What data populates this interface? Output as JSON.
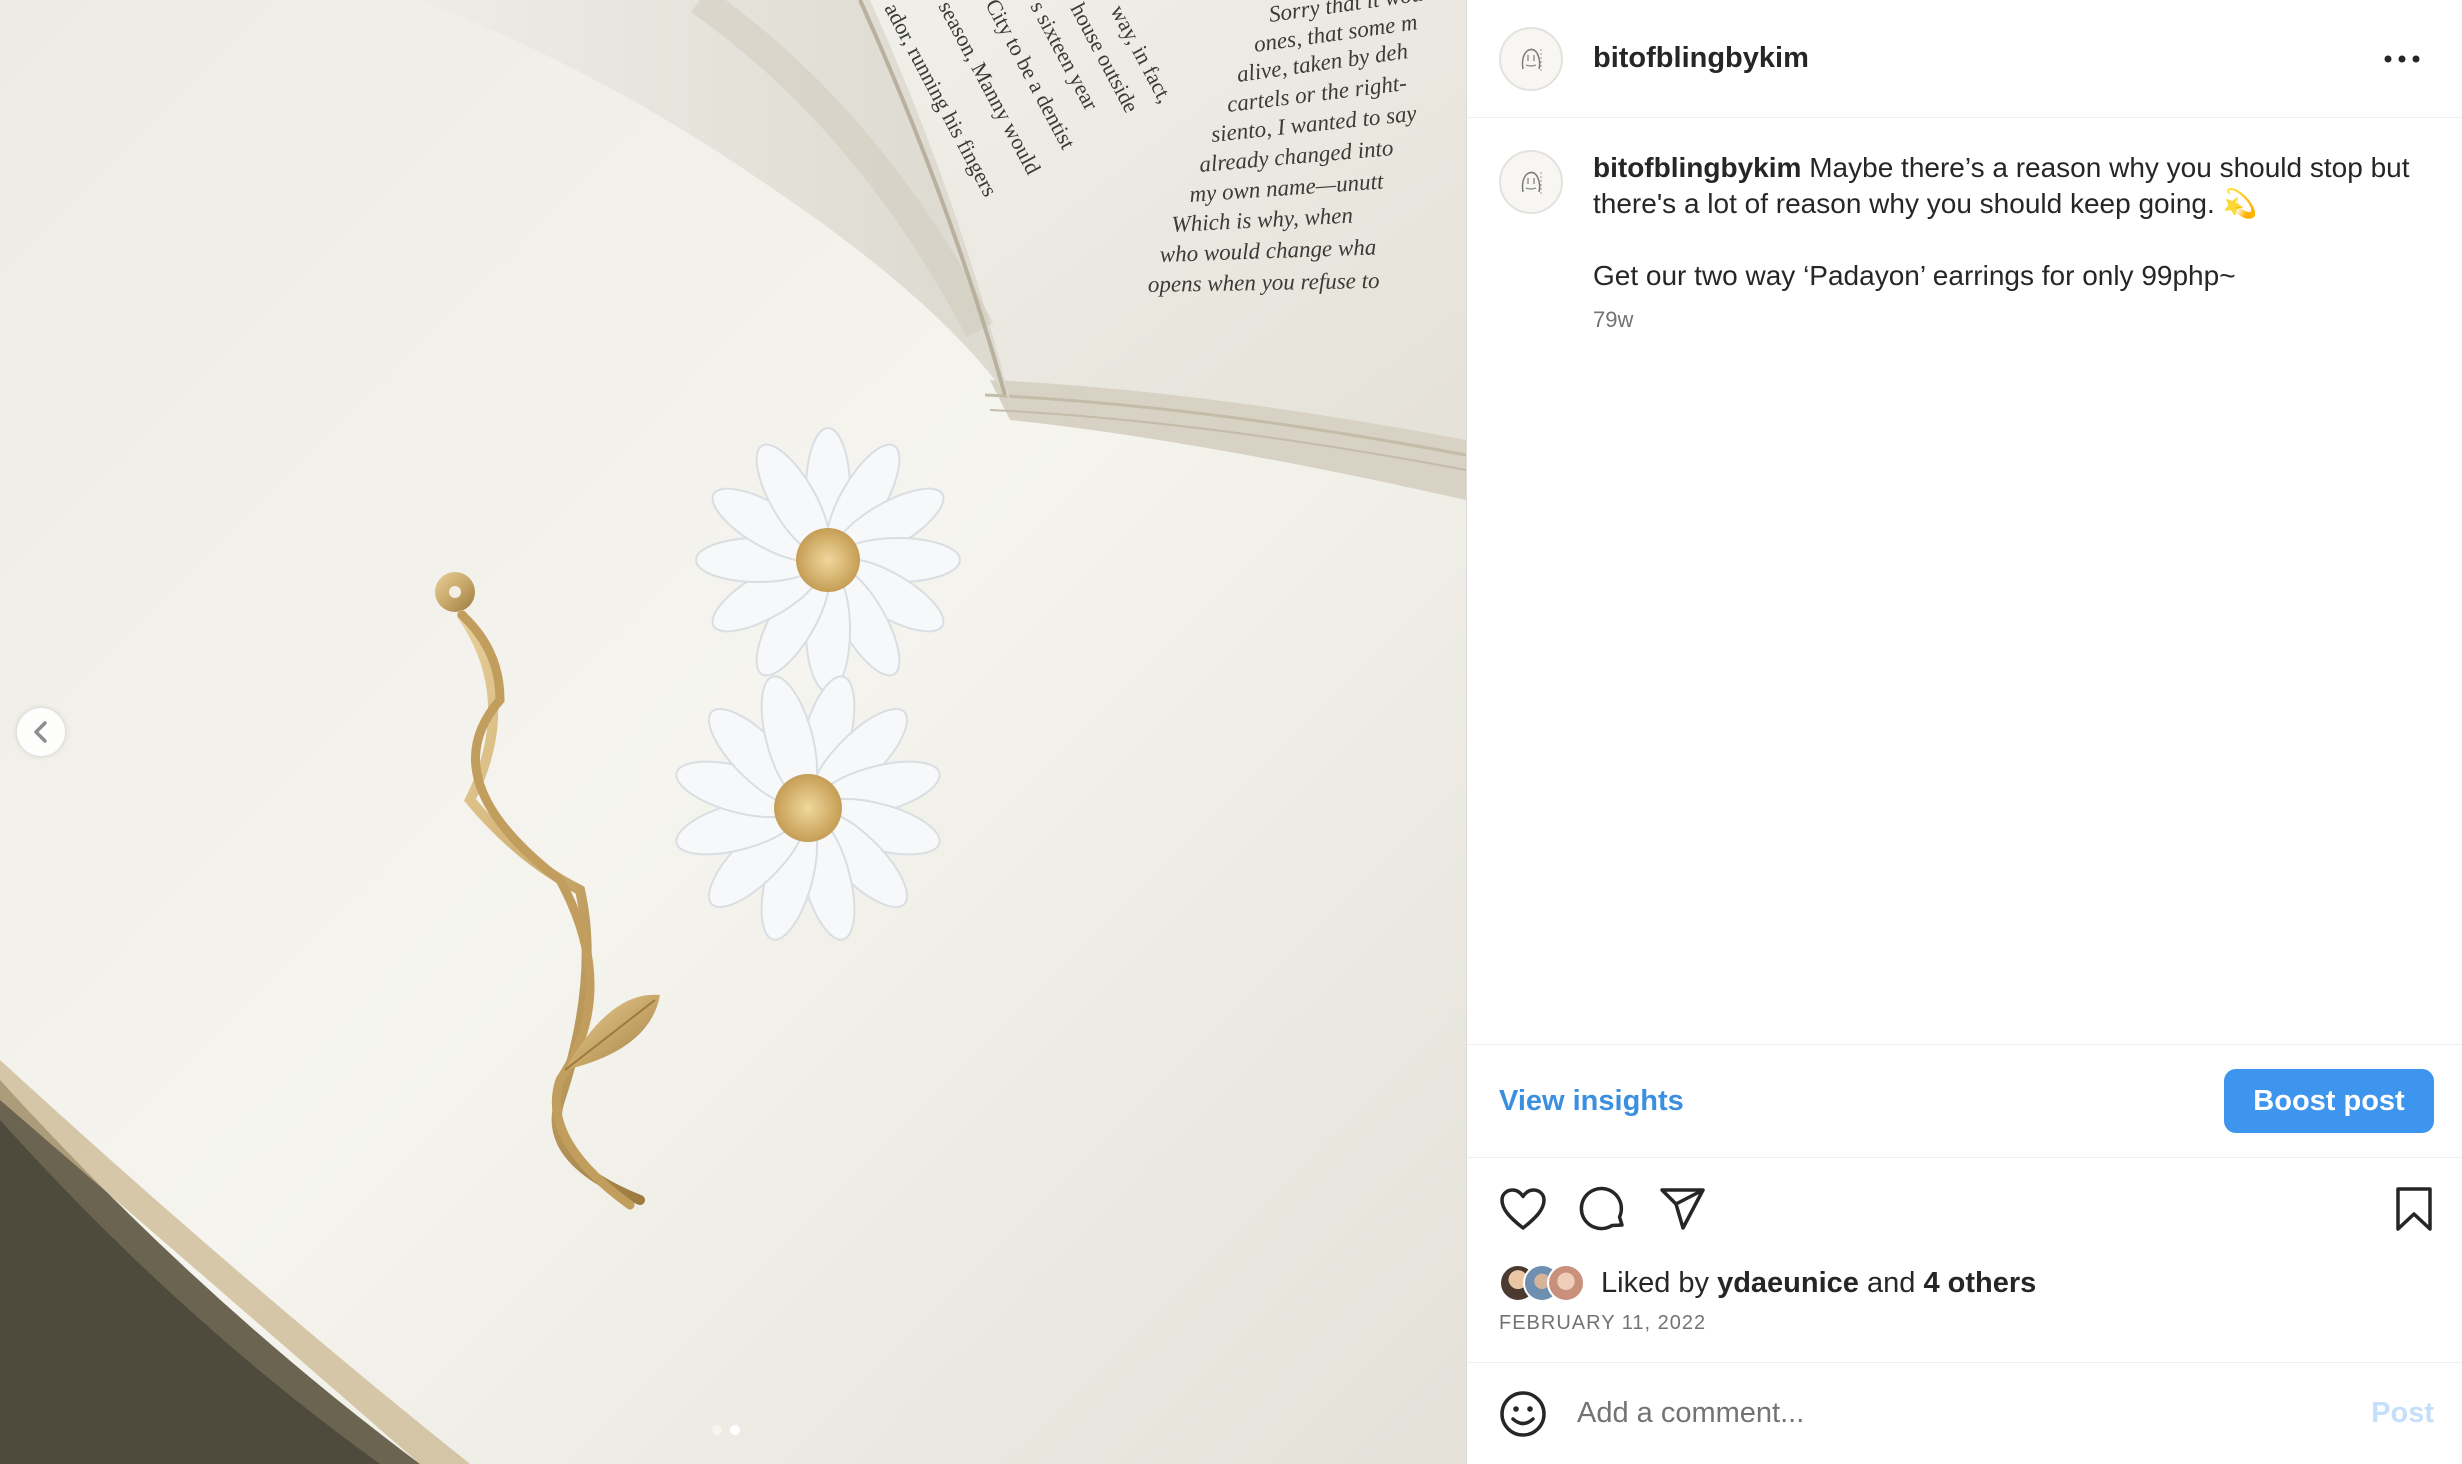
{
  "post": {
    "username": "bitofblingbykim",
    "caption_line1": "Maybe there’s a reason why you should stop but there's a lot of reason why you should keep going. 💫",
    "caption_line2": "Get our two way ‘Padayon’ earrings for only 99php~",
    "time_ago": "79w",
    "date": "FEBRUARY 11, 2022"
  },
  "actions": {
    "view_insights": "View insights",
    "boost_post": "Boost post",
    "icons": [
      "heart-icon",
      "comment-icon",
      "share-icon",
      "bookmark-icon"
    ]
  },
  "likes": {
    "prefix": "Liked by",
    "user": "ydaeunice",
    "and": "and",
    "others": "4 others"
  },
  "comment": {
    "placeholder": "Add a comment...",
    "post_label": "Post"
  },
  "book_text": [
    "Sorry that it wou",
    "ones, that some m",
    "alive, taken by deh",
    "cartels or the right-",
    "siento, I wanted to say",
    "already changed into",
    "my own name—unutt",
    "Which is why, when",
    "who would change wha",
    "opens when you refuse to"
  ],
  "book_text_left": [
    "way, in fact,",
    "house outside",
    "s sixteen year",
    "City to be a dentist",
    "season, Manny would",
    "ador, running his fingers"
  ],
  "carousel": {
    "slides": 2,
    "active": 2
  },
  "colors": {
    "accent": "#3e95ee",
    "link": "#3b8fe0",
    "muted": "#737373",
    "gold": "#c9a86a"
  }
}
